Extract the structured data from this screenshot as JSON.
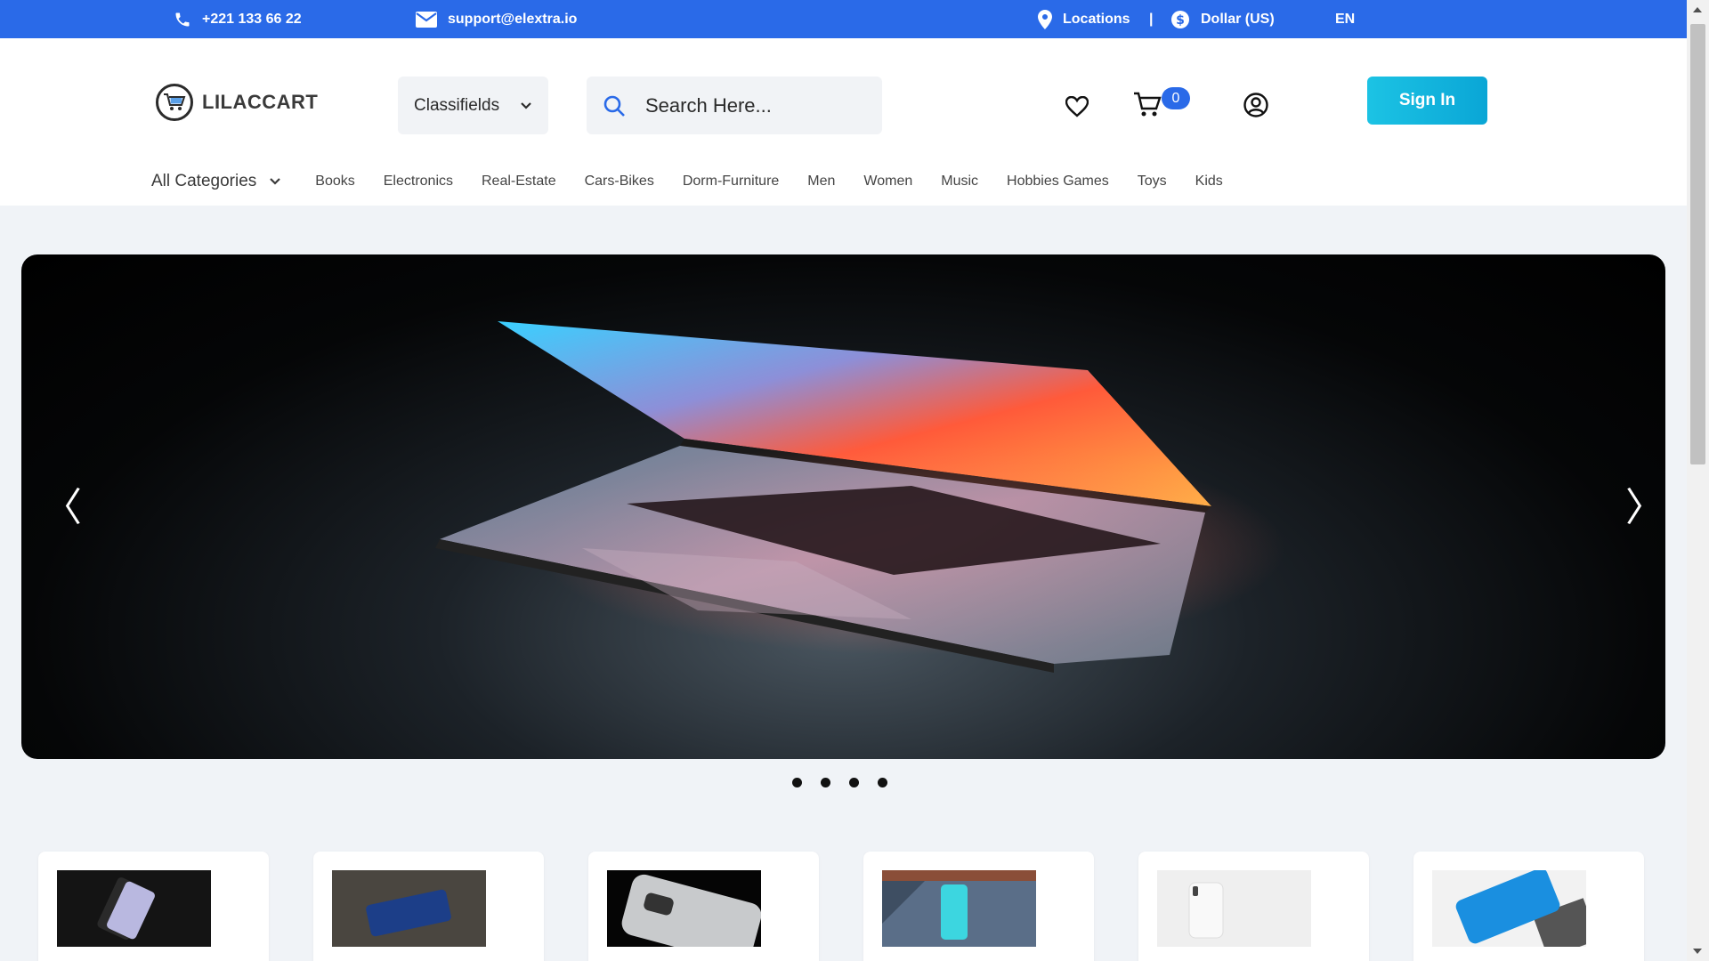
{
  "topbar": {
    "phone": "+221 133 66 22",
    "email": "support@elextra.io",
    "locations": "Locations",
    "separator": "|",
    "currency": "Dollar (US)",
    "language": "EN",
    "bg_color": "#2a6ae8"
  },
  "header": {
    "logo_text": "LILACCART",
    "category_select": "Classifields",
    "search_placeholder": "Search Here...",
    "cart_count": "0",
    "signin_label": "Sign In"
  },
  "nav": {
    "all_categories": "All Categories",
    "links": [
      "Books",
      "Electronics",
      "Real-Estate",
      "Cars-Bikes",
      "Dorm-Furniture",
      "Men",
      "Women",
      "Music",
      "Hobbies Games",
      "Toys",
      "Kids"
    ]
  },
  "hero": {
    "prev": "〈",
    "next": "〉",
    "slide_count": 4
  },
  "products": [
    {
      "icon": "phone-back-silver"
    },
    {
      "icon": "phone-back-blue"
    },
    {
      "icon": "phone-camera-silver"
    },
    {
      "icon": "phone-cyan"
    },
    {
      "icon": "iphone-silver"
    },
    {
      "icon": "iphone-front-screen"
    }
  ]
}
